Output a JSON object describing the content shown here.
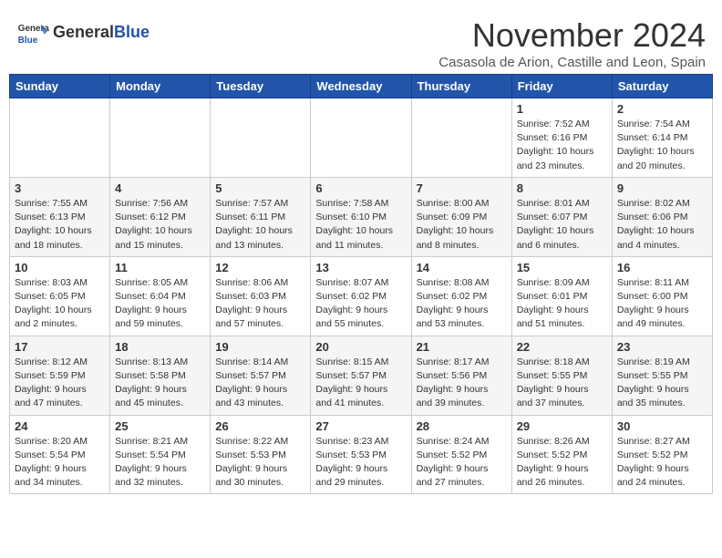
{
  "header": {
    "logo_general": "General",
    "logo_blue": "Blue",
    "month_title": "November 2024",
    "location": "Casasola de Arion, Castille and Leon, Spain"
  },
  "columns": [
    "Sunday",
    "Monday",
    "Tuesday",
    "Wednesday",
    "Thursday",
    "Friday",
    "Saturday"
  ],
  "weeks": [
    [
      {
        "day": "",
        "info": ""
      },
      {
        "day": "",
        "info": ""
      },
      {
        "day": "",
        "info": ""
      },
      {
        "day": "",
        "info": ""
      },
      {
        "day": "",
        "info": ""
      },
      {
        "day": "1",
        "info": "Sunrise: 7:52 AM\nSunset: 6:16 PM\nDaylight: 10 hours and 23 minutes."
      },
      {
        "day": "2",
        "info": "Sunrise: 7:54 AM\nSunset: 6:14 PM\nDaylight: 10 hours and 20 minutes."
      }
    ],
    [
      {
        "day": "3",
        "info": "Sunrise: 7:55 AM\nSunset: 6:13 PM\nDaylight: 10 hours and 18 minutes."
      },
      {
        "day": "4",
        "info": "Sunrise: 7:56 AM\nSunset: 6:12 PM\nDaylight: 10 hours and 15 minutes."
      },
      {
        "day": "5",
        "info": "Sunrise: 7:57 AM\nSunset: 6:11 PM\nDaylight: 10 hours and 13 minutes."
      },
      {
        "day": "6",
        "info": "Sunrise: 7:58 AM\nSunset: 6:10 PM\nDaylight: 10 hours and 11 minutes."
      },
      {
        "day": "7",
        "info": "Sunrise: 8:00 AM\nSunset: 6:09 PM\nDaylight: 10 hours and 8 minutes."
      },
      {
        "day": "8",
        "info": "Sunrise: 8:01 AM\nSunset: 6:07 PM\nDaylight: 10 hours and 6 minutes."
      },
      {
        "day": "9",
        "info": "Sunrise: 8:02 AM\nSunset: 6:06 PM\nDaylight: 10 hours and 4 minutes."
      }
    ],
    [
      {
        "day": "10",
        "info": "Sunrise: 8:03 AM\nSunset: 6:05 PM\nDaylight: 10 hours and 2 minutes."
      },
      {
        "day": "11",
        "info": "Sunrise: 8:05 AM\nSunset: 6:04 PM\nDaylight: 9 hours and 59 minutes."
      },
      {
        "day": "12",
        "info": "Sunrise: 8:06 AM\nSunset: 6:03 PM\nDaylight: 9 hours and 57 minutes."
      },
      {
        "day": "13",
        "info": "Sunrise: 8:07 AM\nSunset: 6:02 PM\nDaylight: 9 hours and 55 minutes."
      },
      {
        "day": "14",
        "info": "Sunrise: 8:08 AM\nSunset: 6:02 PM\nDaylight: 9 hours and 53 minutes."
      },
      {
        "day": "15",
        "info": "Sunrise: 8:09 AM\nSunset: 6:01 PM\nDaylight: 9 hours and 51 minutes."
      },
      {
        "day": "16",
        "info": "Sunrise: 8:11 AM\nSunset: 6:00 PM\nDaylight: 9 hours and 49 minutes."
      }
    ],
    [
      {
        "day": "17",
        "info": "Sunrise: 8:12 AM\nSunset: 5:59 PM\nDaylight: 9 hours and 47 minutes."
      },
      {
        "day": "18",
        "info": "Sunrise: 8:13 AM\nSunset: 5:58 PM\nDaylight: 9 hours and 45 minutes."
      },
      {
        "day": "19",
        "info": "Sunrise: 8:14 AM\nSunset: 5:57 PM\nDaylight: 9 hours and 43 minutes."
      },
      {
        "day": "20",
        "info": "Sunrise: 8:15 AM\nSunset: 5:57 PM\nDaylight: 9 hours and 41 minutes."
      },
      {
        "day": "21",
        "info": "Sunrise: 8:17 AM\nSunset: 5:56 PM\nDaylight: 9 hours and 39 minutes."
      },
      {
        "day": "22",
        "info": "Sunrise: 8:18 AM\nSunset: 5:55 PM\nDaylight: 9 hours and 37 minutes."
      },
      {
        "day": "23",
        "info": "Sunrise: 8:19 AM\nSunset: 5:55 PM\nDaylight: 9 hours and 35 minutes."
      }
    ],
    [
      {
        "day": "24",
        "info": "Sunrise: 8:20 AM\nSunset: 5:54 PM\nDaylight: 9 hours and 34 minutes."
      },
      {
        "day": "25",
        "info": "Sunrise: 8:21 AM\nSunset: 5:54 PM\nDaylight: 9 hours and 32 minutes."
      },
      {
        "day": "26",
        "info": "Sunrise: 8:22 AM\nSunset: 5:53 PM\nDaylight: 9 hours and 30 minutes."
      },
      {
        "day": "27",
        "info": "Sunrise: 8:23 AM\nSunset: 5:53 PM\nDaylight: 9 hours and 29 minutes."
      },
      {
        "day": "28",
        "info": "Sunrise: 8:24 AM\nSunset: 5:52 PM\nDaylight: 9 hours and 27 minutes."
      },
      {
        "day": "29",
        "info": "Sunrise: 8:26 AM\nSunset: 5:52 PM\nDaylight: 9 hours and 26 minutes."
      },
      {
        "day": "30",
        "info": "Sunrise: 8:27 AM\nSunset: 5:52 PM\nDaylight: 9 hours and 24 minutes."
      }
    ]
  ]
}
